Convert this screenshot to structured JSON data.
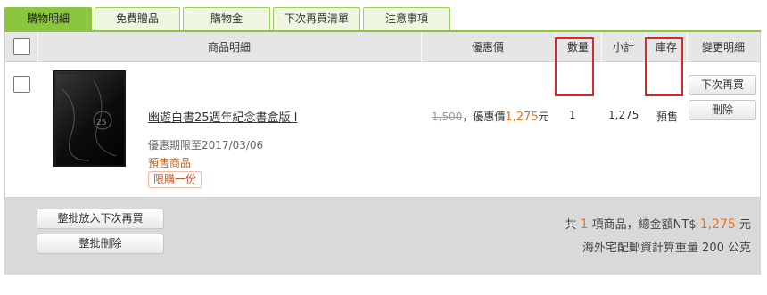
{
  "tabs": [
    "購物明細",
    "免費贈品",
    "購物金",
    "下次再買清單",
    "注意事項"
  ],
  "table_header": {
    "product": "商品明細",
    "price": "優惠價",
    "qty": "數量",
    "subtotal": "小計",
    "stock": "庫存",
    "change": "變更明細"
  },
  "item": {
    "image_name": "product-cover",
    "title": "幽遊白書25週年紀念書盒版 I",
    "orig_price": "1,500",
    "sale_prefix": "，優惠價",
    "sale_price": "1,275",
    "sale_unit": "元",
    "expiry": "優惠期限至2017/03/06",
    "presale_label": "預售商品",
    "limit_label": "限購一份",
    "qty": "1",
    "subtotal": "1,275",
    "stock": "預售",
    "btn_buy_later": "下次再買",
    "btn_delete": "刪除"
  },
  "footer": {
    "btn_batch_later": "整批放入下次再買",
    "btn_batch_delete": "整批刪除",
    "sum_prefix": "共",
    "item_count": "1",
    "sum_middle": "項商品，總金額NT$",
    "total": "1,275",
    "sum_unit": "元",
    "shipping_note": "海外宅配郵資計算重量 200 公克"
  },
  "colors": {
    "accent_green": "#8cc63f",
    "highlight_red": "#d42a2a",
    "price_orange": "#e8761e"
  }
}
